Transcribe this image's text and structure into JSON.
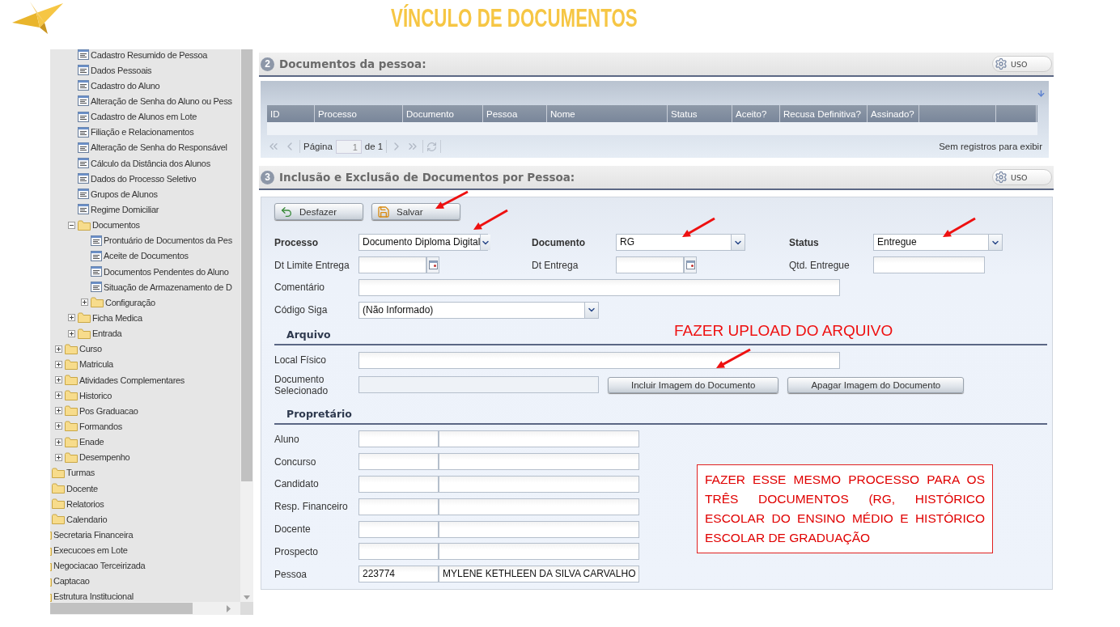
{
  "slide_title": "VÍNCULO DE DOCUMENTOS",
  "sidebar": {
    "tree": [
      {
        "children": [
          {
            "children": [
              {
                "children": [
                  {
                    "label": "Cadastro Resumido de Pessoa",
                    "kind": "page"
                  },
                  {
                    "label": "Dados Pessoais",
                    "kind": "page"
                  },
                  {
                    "label": "Cadastro do Aluno",
                    "kind": "page"
                  },
                  {
                    "label": "Alteração de Senha do Aluno ou Pess",
                    "kind": "page"
                  },
                  {
                    "label": "Cadastro de Alunos em Lote",
                    "kind": "page"
                  },
                  {
                    "label": "Filiação e Relacionamentos",
                    "kind": "page"
                  },
                  {
                    "label": "Alteração de Senha do Responsável",
                    "kind": "page"
                  },
                  {
                    "label": "Cálculo da Distância dos Alunos",
                    "kind": "page"
                  },
                  {
                    "label": "Dados do Processo Seletivo",
                    "kind": "page"
                  },
                  {
                    "label": "Grupos de Alunos",
                    "kind": "page"
                  },
                  {
                    "label": "Regime Domiciliar",
                    "kind": "page"
                  },
                  {
                    "label": "Documentos",
                    "kind": "folder",
                    "expanded": true,
                    "children": [
                      {
                        "label": "Prontuário de Documentos da Pes",
                        "kind": "page"
                      },
                      {
                        "label": "Aceite de Documentos",
                        "kind": "page"
                      },
                      {
                        "label": "Documentos Pendentes do Aluno",
                        "kind": "page"
                      },
                      {
                        "label": "Situação de Armazenamento de D",
                        "kind": "page"
                      },
                      {
                        "label": "Configuração",
                        "kind": "folder",
                        "expanded": false
                      }
                    ]
                  },
                  {
                    "label": "Ficha Medica",
                    "kind": "folder",
                    "expanded": false
                  },
                  {
                    "label": "Entrada",
                    "kind": "folder",
                    "expanded": false
                  }
                ]
              },
              {
                "label": "Curso",
                "kind": "folder",
                "expanded": false
              },
              {
                "label": "Matricula",
                "kind": "folder",
                "expanded": false
              },
              {
                "label": "Atividades Complementares",
                "kind": "folder",
                "expanded": false
              },
              {
                "label": "Historico",
                "kind": "folder",
                "expanded": false
              },
              {
                "label": "Pos Graduacao",
                "kind": "folder",
                "expanded": false
              },
              {
                "label": "Formandos",
                "kind": "folder",
                "expanded": false
              },
              {
                "label": "Enade",
                "kind": "folder",
                "expanded": false
              },
              {
                "label": "Desempenho",
                "kind": "folder",
                "expanded": false
              }
            ]
          },
          {
            "label": "Turmas",
            "kind": "folder"
          },
          {
            "label": "Docente",
            "kind": "folder"
          },
          {
            "label": "Relatorios",
            "kind": "folder"
          },
          {
            "label": "Calendario",
            "kind": "folder"
          }
        ]
      },
      {
        "label": "Secretaria Financeira",
        "kind": "folder"
      },
      {
        "label": "Execucoes em Lote",
        "kind": "folder"
      },
      {
        "label": "Negociacao Terceirizada",
        "kind": "folder"
      },
      {
        "label": "Captacao",
        "kind": "folder"
      },
      {
        "label": "Estrutura Institucional",
        "kind": "folder"
      }
    ]
  },
  "documents_panel": {
    "number": "2",
    "title": "Documentos da pessoa:",
    "toggle_label": "USO",
    "columns": [
      "ID",
      "Processo",
      "Documento",
      "Pessoa",
      "Nome",
      "Status",
      "Aceito?",
      "Recusa Definitiva?",
      "Assinado?"
    ],
    "pager": {
      "page_label": "Página",
      "page_value": "1",
      "of_label": "de 1",
      "status": "Sem registros para exibir"
    }
  },
  "form_panel": {
    "number": "3",
    "title": "Inclusão e Exclusão de Documentos por Pessoa:",
    "toggle_label": "USO",
    "buttons": [
      {
        "label": "Desfazer",
        "kind": "undo"
      },
      {
        "label": "Salvar",
        "kind": "save"
      }
    ],
    "rows": [
      [
        {
          "label": "Processo",
          "required": true,
          "kind": "select",
          "value": "Documento Diploma Digital"
        },
        {
          "label": "Documento",
          "required": true,
          "kind": "select",
          "value": "RG"
        },
        {
          "label": "Status",
          "required": true,
          "kind": "select",
          "value": "Entregue"
        }
      ],
      [
        {
          "label": "Dt Limite Entrega",
          "required": false,
          "kind": "date"
        },
        {
          "label": "Dt Entrega",
          "required": false,
          "kind": "date"
        },
        {
          "label": "Qtd. Entregue",
          "required": false,
          "kind": "text"
        }
      ],
      [
        {
          "label": "Comentário",
          "required": false,
          "kind": "text"
        }
      ],
      [
        {
          "label": "Código Siga",
          "required": false,
          "kind": "select",
          "value": "(Não Informado)"
        }
      ]
    ],
    "file_section": {
      "title": "Arquivo",
      "local_label": "Local Físico",
      "selected_label": "Documento Selecionado",
      "buttons": [
        "Incluir Imagem do Documento",
        "Apagar Imagem do Documento"
      ]
    },
    "owner_section": {
      "title": "Propretário",
      "rows": [
        {
          "label": "Aluno"
        },
        {
          "label": "Concurso"
        },
        {
          "label": "Candidato"
        },
        {
          "label": "Resp. Financeiro"
        },
        {
          "label": "Docente"
        },
        {
          "label": "Prospecto"
        },
        {
          "label": "Pessoa",
          "code": "223774",
          "name": "MYLENE KETHLEEN DA SILVA CARVALHO"
        }
      ]
    }
  },
  "annotations": {
    "upload_note": "FAZER UPLOAD DO ARQUIVO",
    "process_note": "FAZER ESSE MESMO PROCESSO PARA OS TRÊS DOCUMENTOS (RG, HISTÓRICO ESCOLAR DO ENSINO MÉDIO E HISTÓRICO ESCOLAR DE GRADUAÇÃO"
  }
}
